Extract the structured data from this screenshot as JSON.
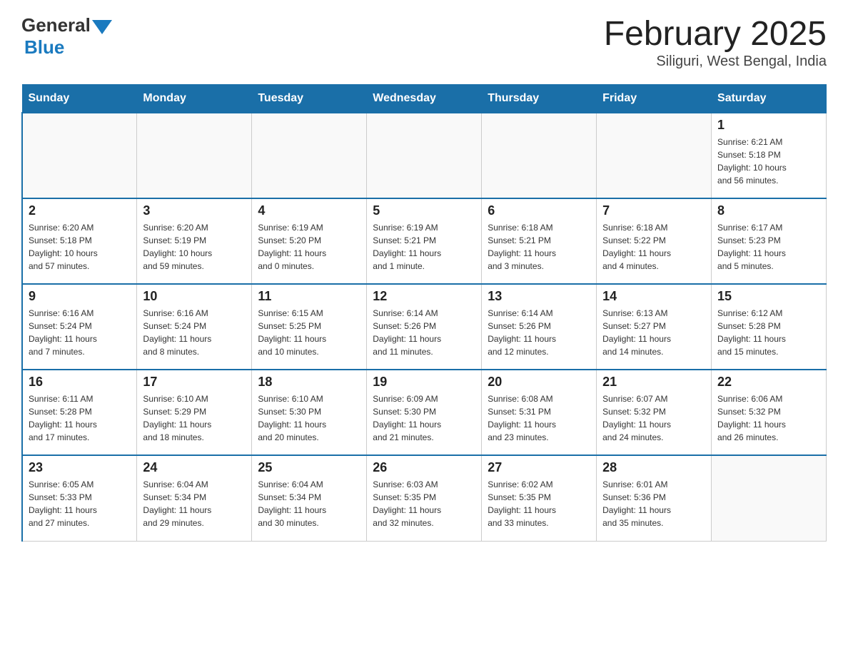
{
  "header": {
    "logo_general": "General",
    "logo_blue": "Blue",
    "month_title": "February 2025",
    "location": "Siliguri, West Bengal, India"
  },
  "weekdays": [
    "Sunday",
    "Monday",
    "Tuesday",
    "Wednesday",
    "Thursday",
    "Friday",
    "Saturday"
  ],
  "weeks": [
    [
      {
        "day": "",
        "info": ""
      },
      {
        "day": "",
        "info": ""
      },
      {
        "day": "",
        "info": ""
      },
      {
        "day": "",
        "info": ""
      },
      {
        "day": "",
        "info": ""
      },
      {
        "day": "",
        "info": ""
      },
      {
        "day": "1",
        "info": "Sunrise: 6:21 AM\nSunset: 5:18 PM\nDaylight: 10 hours\nand 56 minutes."
      }
    ],
    [
      {
        "day": "2",
        "info": "Sunrise: 6:20 AM\nSunset: 5:18 PM\nDaylight: 10 hours\nand 57 minutes."
      },
      {
        "day": "3",
        "info": "Sunrise: 6:20 AM\nSunset: 5:19 PM\nDaylight: 10 hours\nand 59 minutes."
      },
      {
        "day": "4",
        "info": "Sunrise: 6:19 AM\nSunset: 5:20 PM\nDaylight: 11 hours\nand 0 minutes."
      },
      {
        "day": "5",
        "info": "Sunrise: 6:19 AM\nSunset: 5:21 PM\nDaylight: 11 hours\nand 1 minute."
      },
      {
        "day": "6",
        "info": "Sunrise: 6:18 AM\nSunset: 5:21 PM\nDaylight: 11 hours\nand 3 minutes."
      },
      {
        "day": "7",
        "info": "Sunrise: 6:18 AM\nSunset: 5:22 PM\nDaylight: 11 hours\nand 4 minutes."
      },
      {
        "day": "8",
        "info": "Sunrise: 6:17 AM\nSunset: 5:23 PM\nDaylight: 11 hours\nand 5 minutes."
      }
    ],
    [
      {
        "day": "9",
        "info": "Sunrise: 6:16 AM\nSunset: 5:24 PM\nDaylight: 11 hours\nand 7 minutes."
      },
      {
        "day": "10",
        "info": "Sunrise: 6:16 AM\nSunset: 5:24 PM\nDaylight: 11 hours\nand 8 minutes."
      },
      {
        "day": "11",
        "info": "Sunrise: 6:15 AM\nSunset: 5:25 PM\nDaylight: 11 hours\nand 10 minutes."
      },
      {
        "day": "12",
        "info": "Sunrise: 6:14 AM\nSunset: 5:26 PM\nDaylight: 11 hours\nand 11 minutes."
      },
      {
        "day": "13",
        "info": "Sunrise: 6:14 AM\nSunset: 5:26 PM\nDaylight: 11 hours\nand 12 minutes."
      },
      {
        "day": "14",
        "info": "Sunrise: 6:13 AM\nSunset: 5:27 PM\nDaylight: 11 hours\nand 14 minutes."
      },
      {
        "day": "15",
        "info": "Sunrise: 6:12 AM\nSunset: 5:28 PM\nDaylight: 11 hours\nand 15 minutes."
      }
    ],
    [
      {
        "day": "16",
        "info": "Sunrise: 6:11 AM\nSunset: 5:28 PM\nDaylight: 11 hours\nand 17 minutes."
      },
      {
        "day": "17",
        "info": "Sunrise: 6:10 AM\nSunset: 5:29 PM\nDaylight: 11 hours\nand 18 minutes."
      },
      {
        "day": "18",
        "info": "Sunrise: 6:10 AM\nSunset: 5:30 PM\nDaylight: 11 hours\nand 20 minutes."
      },
      {
        "day": "19",
        "info": "Sunrise: 6:09 AM\nSunset: 5:30 PM\nDaylight: 11 hours\nand 21 minutes."
      },
      {
        "day": "20",
        "info": "Sunrise: 6:08 AM\nSunset: 5:31 PM\nDaylight: 11 hours\nand 23 minutes."
      },
      {
        "day": "21",
        "info": "Sunrise: 6:07 AM\nSunset: 5:32 PM\nDaylight: 11 hours\nand 24 minutes."
      },
      {
        "day": "22",
        "info": "Sunrise: 6:06 AM\nSunset: 5:32 PM\nDaylight: 11 hours\nand 26 minutes."
      }
    ],
    [
      {
        "day": "23",
        "info": "Sunrise: 6:05 AM\nSunset: 5:33 PM\nDaylight: 11 hours\nand 27 minutes."
      },
      {
        "day": "24",
        "info": "Sunrise: 6:04 AM\nSunset: 5:34 PM\nDaylight: 11 hours\nand 29 minutes."
      },
      {
        "day": "25",
        "info": "Sunrise: 6:04 AM\nSunset: 5:34 PM\nDaylight: 11 hours\nand 30 minutes."
      },
      {
        "day": "26",
        "info": "Sunrise: 6:03 AM\nSunset: 5:35 PM\nDaylight: 11 hours\nand 32 minutes."
      },
      {
        "day": "27",
        "info": "Sunrise: 6:02 AM\nSunset: 5:35 PM\nDaylight: 11 hours\nand 33 minutes."
      },
      {
        "day": "28",
        "info": "Sunrise: 6:01 AM\nSunset: 5:36 PM\nDaylight: 11 hours\nand 35 minutes."
      },
      {
        "day": "",
        "info": ""
      }
    ]
  ]
}
